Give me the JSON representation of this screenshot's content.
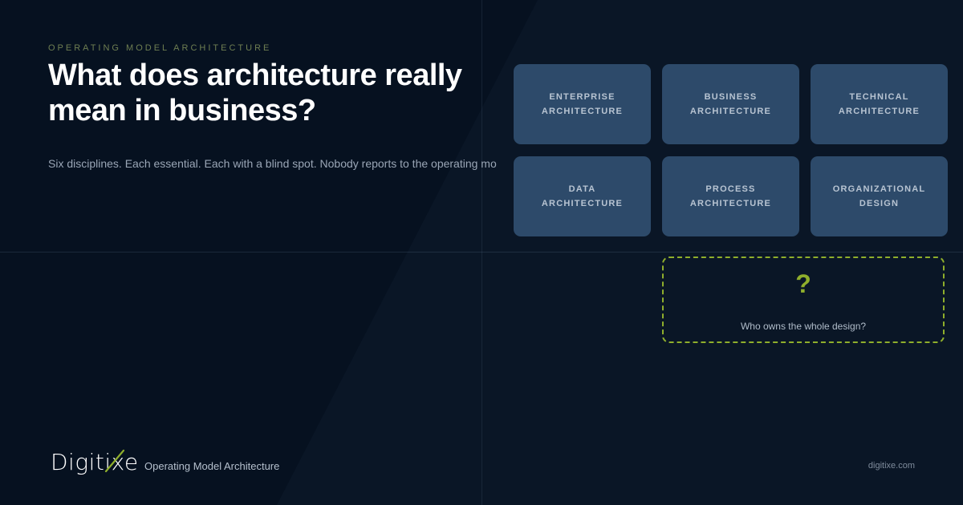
{
  "eyebrow": "OPERATING MODEL ARCHITECTURE",
  "title": "What does architecture really mean in business?",
  "subtitle": "Six disciplines. Each essential. Each with a blind spot. Nobody reports to the operating mo",
  "disciplines": [
    "ENTERPRISE\nARCHITECTURE",
    "BUSINESS\nARCHITECTURE",
    "TECHNICAL\nARCHITECTURE",
    "DATA\nARCHITECTURE",
    "PROCESS\nARCHITECTURE",
    "ORGANIZATIONAL\nDESIGN"
  ],
  "question": {
    "mark": "?",
    "text": "Who owns the whole design?"
  },
  "footer": {
    "logo": "Digitixe",
    "label": "Operating Model Architecture",
    "url": "digitixe.com"
  },
  "colors": {
    "background": "#061120",
    "tile": "#2d4a6a",
    "accent": "#8fae2c"
  }
}
